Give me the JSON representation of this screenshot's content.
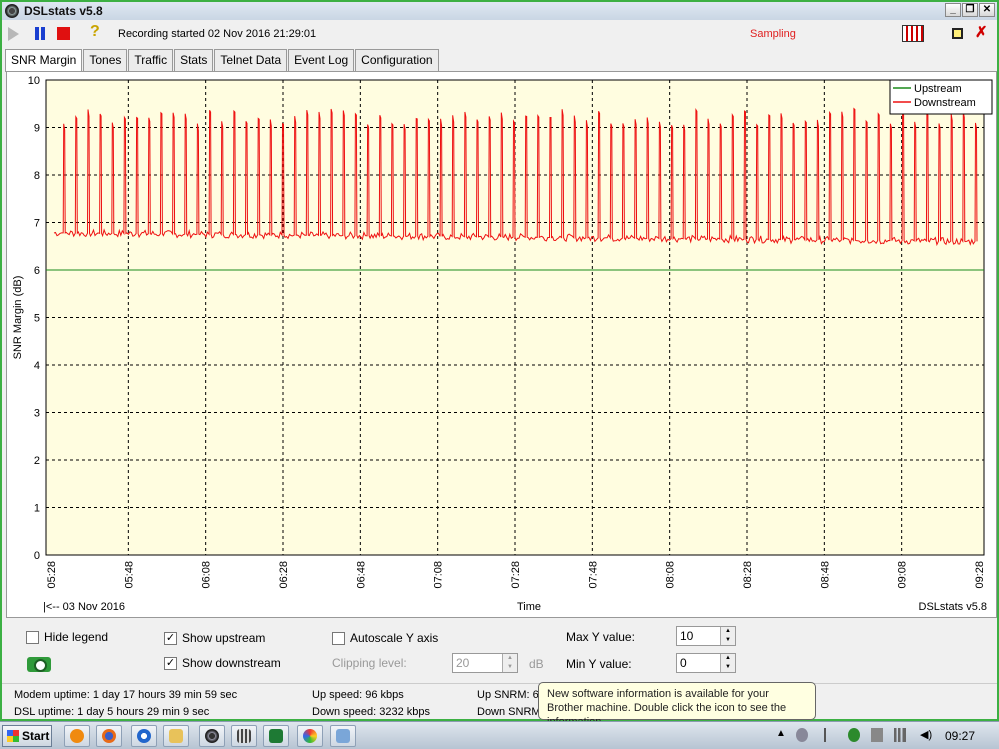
{
  "window": {
    "title": "DSLstats v5.8"
  },
  "toolbar": {
    "recording_text": "Recording started 02 Nov 2016 21:29:01",
    "status_text": "Sampling"
  },
  "tabs": [
    {
      "label": "SNR Margin",
      "active": true
    },
    {
      "label": "Tones",
      "active": false
    },
    {
      "label": "Traffic",
      "active": false
    },
    {
      "label": "Stats",
      "active": false
    },
    {
      "label": "Telnet Data",
      "active": false
    },
    {
      "label": "Event Log",
      "active": false
    },
    {
      "label": "Configuration",
      "active": false
    }
  ],
  "chart_data": {
    "type": "line",
    "ylabel": "SNR Margin (dB)",
    "xlabel": "Time",
    "date_label": "|<-- 03 Nov 2016",
    "watermark": "DSLstats v5.8",
    "ylim": [
      0,
      10
    ],
    "yticks": [
      "0",
      "1",
      "2",
      "3",
      "4",
      "5",
      "6",
      "7",
      "8",
      "9",
      "10"
    ],
    "xticks": [
      "05:28",
      "05:48",
      "06:08",
      "06:28",
      "06:48",
      "07:08",
      "07:28",
      "07:48",
      "08:08",
      "08:28",
      "08:48",
      "09:08",
      "09:28"
    ],
    "grid": true,
    "legend_position": "top-right",
    "background": "#fffde0",
    "series": [
      {
        "name": "Upstream",
        "color": "#1a8a1a",
        "baseline": 6.0
      },
      {
        "name": "Downstream",
        "color": "#ee1111",
        "baseline_start": 6.78,
        "baseline_end": 6.6,
        "spike_peak": 9.4,
        "spike_count": 76
      }
    ]
  },
  "controls": {
    "hide_legend": "Hide legend",
    "show_upstream": "Show upstream",
    "show_downstream": "Show downstream",
    "autoscale": "Autoscale Y axis",
    "clipping_label": "Clipping level:",
    "clipping_value": "20",
    "clipping_unit": "dB",
    "max_y_label": "Max Y value:",
    "max_y_value": "10",
    "min_y_label": "Min Y value:",
    "min_y_value": "0"
  },
  "status": {
    "modem_uptime": "Modem uptime: 1 day 17 hours 39 min 59 sec",
    "dsl_uptime": "DSL uptime: 1 day 5 hours 29 min 9 sec",
    "up_speed": "Up speed: 96 kbps",
    "down_speed": "Down speed: 3232 kbps",
    "up_snrm": "Up SNRM: 6.0",
    "down_snrm": "Down SNRM:"
  },
  "balloon": {
    "text": "New software information is available for your Brother machine. Double click the icon to see the information."
  },
  "taskbar": {
    "start": "Start",
    "clock": "09:27"
  }
}
